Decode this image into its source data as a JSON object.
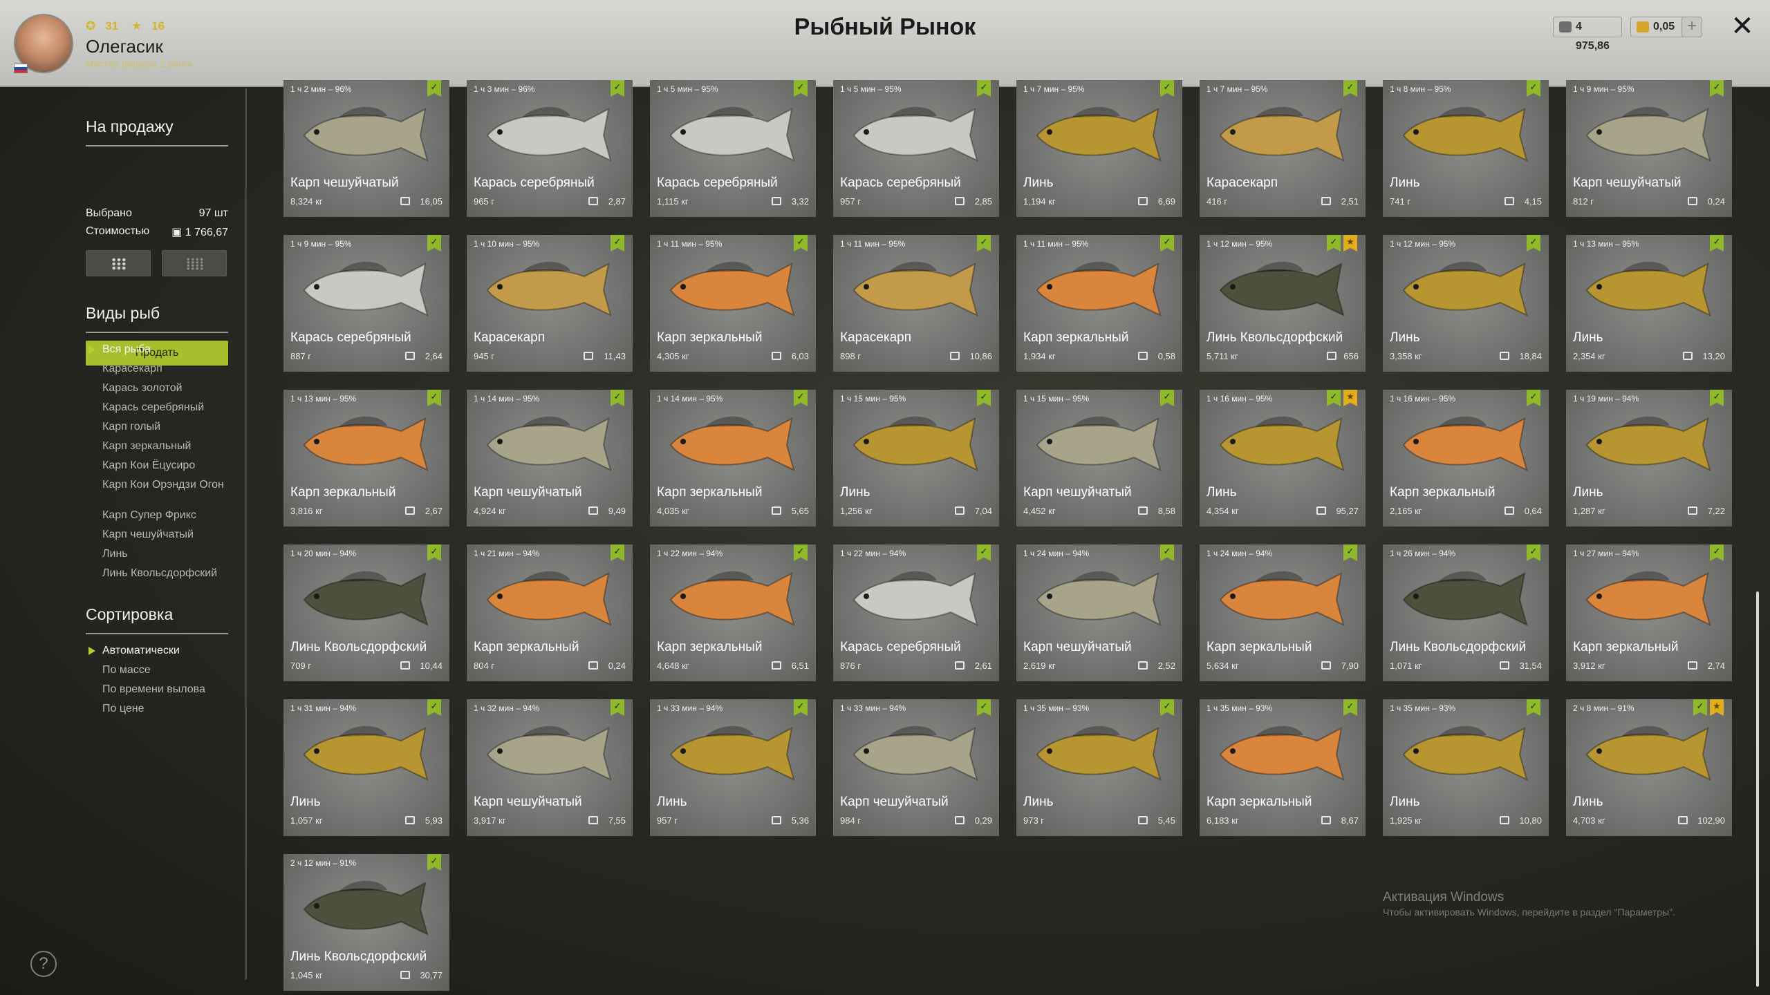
{
  "header": {
    "title": "Рыбный Рынок",
    "player": {
      "stat_level": "31",
      "stat_rank": "16",
      "name": "Олегасик",
      "rank_title": "Мастер фидера 2 ранга"
    },
    "currency_silver": "4 975,86",
    "currency_gold": "0,05",
    "add_symbol": "+",
    "close_symbol": "✕"
  },
  "sidebar": {
    "for_sale_title": "На продажу",
    "selected_label": "Выбрано",
    "selected_value": "97 шт",
    "cost_label": "Стоимостью",
    "cost_value": "1 766,67",
    "sell_button": "Продать",
    "species_title": "Виды рыб",
    "species": [
      {
        "label": "Вся рыба",
        "active": true
      },
      {
        "label": "Карасекарп"
      },
      {
        "label": "Карась золотой"
      },
      {
        "label": "Карась серебряный"
      },
      {
        "label": "Карп голый"
      },
      {
        "label": "Карп зеркальный"
      },
      {
        "label": "Карп Кои Ёцусиро"
      },
      {
        "label": "Карп Кои Орэндзи Огон"
      },
      {
        "label": "Карп Супер Фрикс"
      },
      {
        "label": "Карп чешуйчатый"
      },
      {
        "label": "Линь"
      },
      {
        "label": "Линь Квольсдорфский"
      }
    ],
    "sort_title": "Сортировка",
    "sort_options": [
      {
        "label": "Автоматически",
        "active": true
      },
      {
        "label": "По массе"
      },
      {
        "label": "По времени вылова"
      },
      {
        "label": "По цене"
      }
    ],
    "help_symbol": "?"
  },
  "cards": [
    {
      "time": "1 ч 2 мин – 96%",
      "name": "Карп чешуйчатый",
      "weight": "8,324 кг",
      "price": "16,05",
      "badges": [
        "green"
      ]
    },
    {
      "time": "1 ч 3 мин – 96%",
      "name": "Карась серебряный",
      "weight": "965 г",
      "price": "2,87",
      "badges": [
        "green"
      ]
    },
    {
      "time": "1 ч 5 мин – 95%",
      "name": "Карась серебряный",
      "weight": "1,115 кг",
      "price": "3,32",
      "badges": [
        "green"
      ]
    },
    {
      "time": "1 ч 5 мин – 95%",
      "name": "Карась серебряный",
      "weight": "957 г",
      "price": "2,85",
      "badges": [
        "green"
      ]
    },
    {
      "time": "1 ч 7 мин – 95%",
      "name": "Линь",
      "weight": "1,194 кг",
      "price": "6,69",
      "badges": [
        "green"
      ]
    },
    {
      "time": "1 ч 7 мин – 95%",
      "name": "Карасекарп",
      "weight": "416 г",
      "price": "2,51",
      "badges": [
        "green"
      ]
    },
    {
      "time": "1 ч 8 мин – 95%",
      "name": "Линь",
      "weight": "741 г",
      "price": "4,15",
      "badges": [
        "green"
      ]
    },
    {
      "time": "1 ч 9 мин – 95%",
      "name": "Карп чешуйчатый",
      "weight": "812 г",
      "price": "0,24",
      "badges": [
        "green"
      ]
    },
    {
      "time": "1 ч 9 мин – 95%",
      "name": "Карась серебряный",
      "weight": "887 г",
      "price": "2,64",
      "badges": [
        "green"
      ]
    },
    {
      "time": "1 ч 10 мин – 95%",
      "name": "Карасекарп",
      "weight": "945 г",
      "price": "11,43",
      "badges": [
        "green"
      ]
    },
    {
      "time": "1 ч 11 мин – 95%",
      "name": "Карп зеркальный",
      "weight": "4,305 кг",
      "price": "6,03",
      "badges": [
        "green"
      ]
    },
    {
      "time": "1 ч 11 мин – 95%",
      "name": "Карасекарп",
      "weight": "898 г",
      "price": "10,86",
      "badges": [
        "green"
      ]
    },
    {
      "time": "1 ч 11 мин – 95%",
      "name": "Карп зеркальный",
      "weight": "1,934 кг",
      "price": "0,58",
      "badges": [
        "green"
      ]
    },
    {
      "time": "1 ч 12 мин – 95%",
      "name": "Линь Квольсдорфский",
      "weight": "5,711 кг",
      "price": "656",
      "badges": [
        "green",
        "gold"
      ]
    },
    {
      "time": "1 ч 12 мин – 95%",
      "name": "Линь",
      "weight": "3,358 кг",
      "price": "18,84",
      "badges": [
        "green"
      ]
    },
    {
      "time": "1 ч 13 мин – 95%",
      "name": "Линь",
      "weight": "2,354 кг",
      "price": "13,20",
      "badges": [
        "green"
      ]
    },
    {
      "time": "1 ч 13 мин – 95%",
      "name": "Карп зеркальный",
      "weight": "3,816 кг",
      "price": "2,67",
      "badges": [
        "green"
      ]
    },
    {
      "time": "1 ч 14 мин – 95%",
      "name": "Карп чешуйчатый",
      "weight": "4,924 кг",
      "price": "9,49",
      "badges": [
        "green"
      ]
    },
    {
      "time": "1 ч 14 мин – 95%",
      "name": "Карп зеркальный",
      "weight": "4,035 кг",
      "price": "5,65",
      "badges": [
        "green"
      ]
    },
    {
      "time": "1 ч 15 мин – 95%",
      "name": "Линь",
      "weight": "1,256 кг",
      "price": "7,04",
      "badges": [
        "green"
      ]
    },
    {
      "time": "1 ч 15 мин – 95%",
      "name": "Карп чешуйчатый",
      "weight": "4,452 кг",
      "price": "8,58",
      "badges": [
        "green"
      ]
    },
    {
      "time": "1 ч 16 мин – 95%",
      "name": "Линь",
      "weight": "4,354 кг",
      "price": "95,27",
      "badges": [
        "green",
        "gold"
      ]
    },
    {
      "time": "1 ч 16 мин – 95%",
      "name": "Карп зеркальный",
      "weight": "2,165 кг",
      "price": "0,64",
      "badges": [
        "green"
      ]
    },
    {
      "time": "1 ч 19 мин – 94%",
      "name": "Линь",
      "weight": "1,287 кг",
      "price": "7,22",
      "badges": [
        "green"
      ]
    },
    {
      "time": "1 ч 20 мин – 94%",
      "name": "Линь Квольсдорфский",
      "weight": "709 г",
      "price": "10,44",
      "badges": [
        "green"
      ]
    },
    {
      "time": "1 ч 21 мин – 94%",
      "name": "Карп зеркальный",
      "weight": "804 г",
      "price": "0,24",
      "badges": [
        "green"
      ]
    },
    {
      "time": "1 ч 22 мин – 94%",
      "name": "Карп зеркальный",
      "weight": "4,648 кг",
      "price": "6,51",
      "badges": [
        "green"
      ]
    },
    {
      "time": "1 ч 22 мин – 94%",
      "name": "Карась серебряный",
      "weight": "876 г",
      "price": "2,61",
      "badges": [
        "green"
      ]
    },
    {
      "time": "1 ч 24 мин – 94%",
      "name": "Карп чешуйчатый",
      "weight": "2,619 кг",
      "price": "2,52",
      "badges": [
        "green"
      ]
    },
    {
      "time": "1 ч 24 мин – 94%",
      "name": "Карп зеркальный",
      "weight": "5,634 кг",
      "price": "7,90",
      "badges": [
        "green"
      ]
    },
    {
      "time": "1 ч 26 мин – 94%",
      "name": "Линь Квольсдорфский",
      "weight": "1,071 кг",
      "price": "31,54",
      "badges": [
        "green"
      ]
    },
    {
      "time": "1 ч 27 мин – 94%",
      "name": "Карп зеркальный",
      "weight": "3,912 кг",
      "price": "2,74",
      "badges": [
        "green"
      ]
    },
    {
      "time": "1 ч 31 мин – 94%",
      "name": "Линь",
      "weight": "1,057 кг",
      "price": "5,93",
      "badges": [
        "green"
      ]
    },
    {
      "time": "1 ч 32 мин – 94%",
      "name": "Карп чешуйчатый",
      "weight": "3,917 кг",
      "price": "7,55",
      "badges": [
        "green"
      ]
    },
    {
      "time": "1 ч 33 мин – 94%",
      "name": "Линь",
      "weight": "957 г",
      "price": "5,36",
      "badges": [
        "green"
      ]
    },
    {
      "time": "1 ч 33 мин – 94%",
      "name": "Карп чешуйчатый",
      "weight": "984 г",
      "price": "0,29",
      "badges": [
        "green"
      ]
    },
    {
      "time": "1 ч 35 мин – 93%",
      "name": "Линь",
      "weight": "973 г",
      "price": "5,45",
      "badges": [
        "green"
      ]
    },
    {
      "time": "1 ч 35 мин – 93%",
      "name": "Карп зеркальный",
      "weight": "6,183 кг",
      "price": "8,67",
      "badges": [
        "green"
      ]
    },
    {
      "time": "1 ч 35 мин – 93%",
      "name": "Линь",
      "weight": "1,925 кг",
      "price": "10,80",
      "badges": [
        "green"
      ]
    },
    {
      "time": "2 ч 8 мин – 91%",
      "name": "Линь",
      "weight": "4,703 кг",
      "price": "102,90",
      "badges": [
        "green",
        "gold"
      ]
    },
    {
      "time": "2 ч 12 мин – 91%",
      "name": "Линь Квольсдорфский",
      "weight": "1,045 кг",
      "price": "30,77",
      "badges": [
        "green"
      ]
    }
  ],
  "fish_colors": {
    "Карп чешуйчатый": "#a7a48a",
    "Карась серебряный": "#c9c8c2",
    "Линь": "#b79530",
    "Карасекарп": "#c39a4a",
    "Карп зеркальный": "#d9853c",
    "Линь Квольсдорфский": "#4d513c"
  },
  "watermark": {
    "line1": "Активация Windows",
    "line2": "Чтобы активировать Windows, перейдите в раздел \"Параметры\"."
  }
}
